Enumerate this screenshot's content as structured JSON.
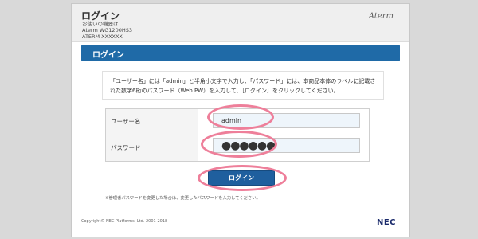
{
  "header": {
    "title": "ログイン",
    "device_label": "お使いの機器は",
    "model": "Aterm WG1200HS3",
    "ssid": "ATERM-XXXXXX",
    "brand": "Aterm"
  },
  "bar": {
    "title": "ログイン"
  },
  "instructions": {
    "line1": "「ユーザー名」には「admin」と半角小文字で入力し、「パスワード」には、本商品本体のラベルに記載さ",
    "line2": "れた数字6桁のパスワード（Web PW）を入力して、［ログイン］をクリックしてください。"
  },
  "form": {
    "username_label": "ユーザー名",
    "username_value": "admin",
    "password_label": "パスワード",
    "password_value": "●●●●●●"
  },
  "login_button": {
    "label": "ログイン"
  },
  "footnote": "※管理者パスワードを変更した場合は、変更したパスワードを入力してください。",
  "footer": {
    "copyright": "Copyright© NEC Platforms, Ltd. 2001-2018",
    "logo": "NEC"
  },
  "colors": {
    "accent": "#1f6aa7",
    "highlight": "#ee7f9a",
    "input_bg": "#eef5fb"
  }
}
